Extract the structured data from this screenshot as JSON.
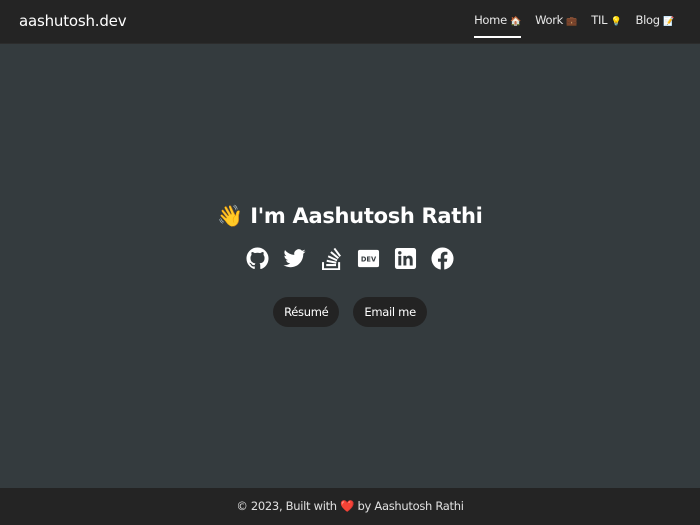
{
  "site": {
    "brand": "aashutosh.dev"
  },
  "nav": {
    "items": [
      {
        "label": "Home",
        "emoji": "🏠",
        "active": true
      },
      {
        "label": "Work",
        "emoji": "💼",
        "active": false
      },
      {
        "label": "TIL",
        "emoji": "💡",
        "active": false
      },
      {
        "label": "Blog",
        "emoji": "📝",
        "active": false
      }
    ]
  },
  "hero": {
    "wave": "👋",
    "greeting": "I'm Aashutosh Rathi",
    "social": [
      {
        "name": "github-icon"
      },
      {
        "name": "twitter-icon"
      },
      {
        "name": "stackoverflow-icon"
      },
      {
        "name": "dev-icon",
        "text": "DEV"
      },
      {
        "name": "linkedin-icon"
      },
      {
        "name": "facebook-icon"
      }
    ],
    "buttons": {
      "resume": "Résumé",
      "email": "Email me"
    }
  },
  "footer": {
    "prefix": "© 2023, Built with",
    "heart": "❤️",
    "suffix": "by Aashutosh Rathi"
  },
  "colors": {
    "background": "#343b3e",
    "navbar": "#242424",
    "button": "#232323",
    "text": "#ffffff"
  }
}
